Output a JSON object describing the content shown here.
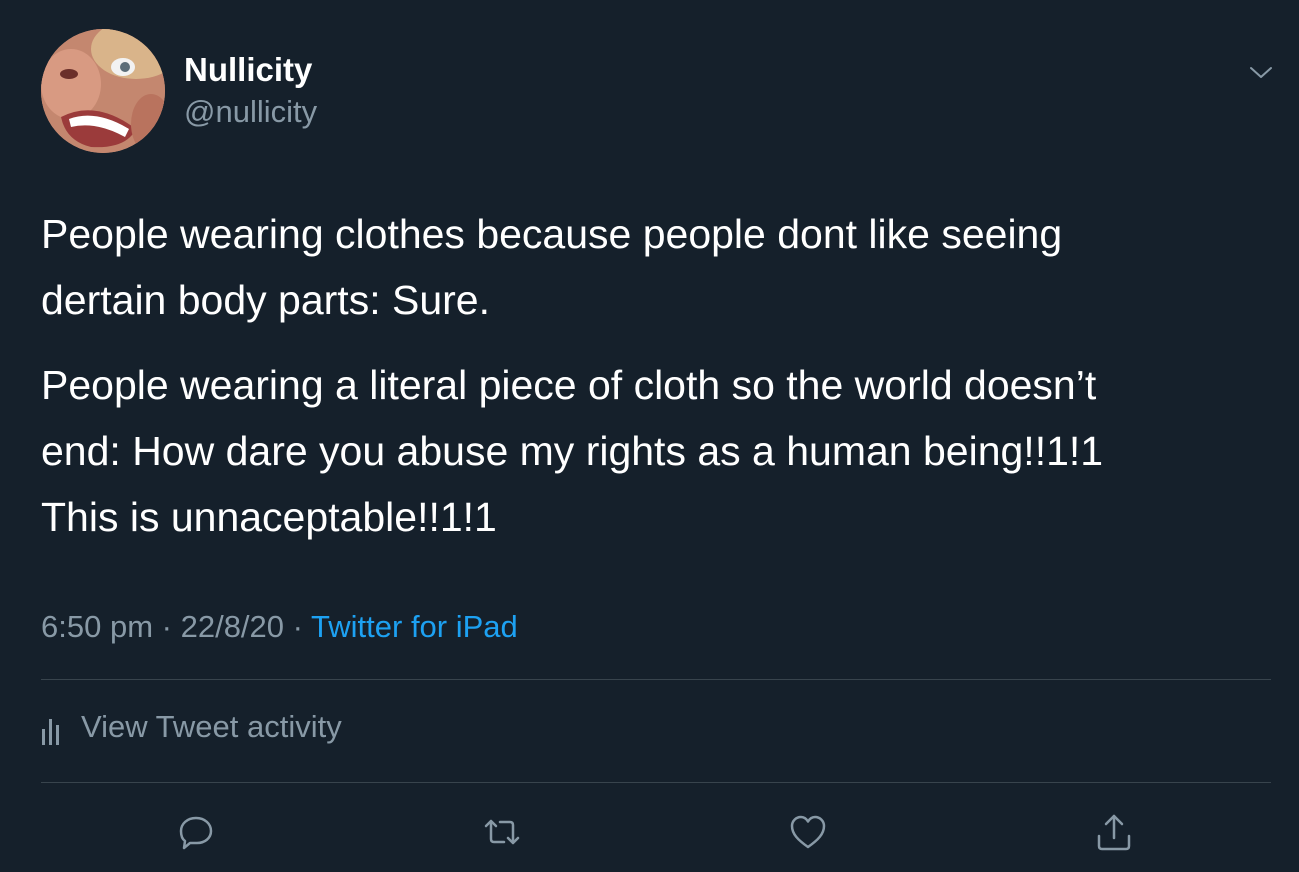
{
  "author": {
    "display_name": "Nullicity",
    "handle": "@nullicity"
  },
  "tweet": {
    "paragraphs": [
      "People wearing clothes because people dont like seeing\ndertain body parts: Sure.",
      "People wearing a literal piece of cloth so the world doesn’t\nend: How dare you abuse my rights as a human being!!1!1\nThis is unnaceptable!!1!1"
    ],
    "time": "6:50 pm",
    "separator": "·",
    "date": "22/8/20",
    "source": "Twitter for iPad"
  },
  "activity": {
    "label": "View Tweet activity",
    "icon": "bar-chart-icon"
  },
  "actions": [
    {
      "name": "reply",
      "icon": "reply-icon"
    },
    {
      "name": "retweet",
      "icon": "retweet-icon"
    },
    {
      "name": "like",
      "icon": "heart-icon"
    },
    {
      "name": "share",
      "icon": "share-icon"
    }
  ],
  "colors": {
    "background": "#15202b",
    "primary_text": "#ffffff",
    "secondary_text": "#8899a6",
    "link": "#1da1f2",
    "divider": "#38444d"
  }
}
